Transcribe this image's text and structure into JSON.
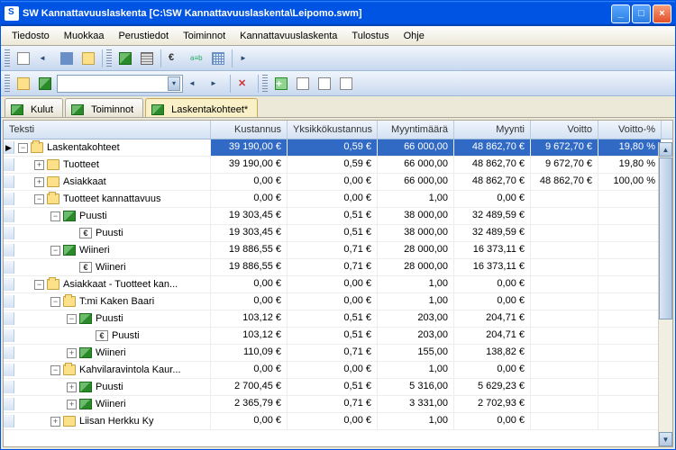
{
  "window": {
    "title": "SW Kannattavuuslaskenta [C:\\SW Kannattavuuslaskenta\\Leipomo.swm]"
  },
  "menubar": {
    "items": [
      "Tiedosto",
      "Muokkaa",
      "Perustiedot",
      "Toiminnot",
      "Kannattavuuslaskenta",
      "Tulostus",
      "Ohje"
    ]
  },
  "tabs": [
    {
      "label": "Kulut",
      "icon": "prod",
      "active": false
    },
    {
      "label": "Toiminnot",
      "icon": "prod",
      "active": false
    },
    {
      "label": "Laskentakohteet*",
      "icon": "prod",
      "active": true
    }
  ],
  "columns": {
    "c0": "Teksti",
    "c1": "Kustannus",
    "c2": "Yksikkökustannus",
    "c3": "Myyntimäärä",
    "c4": "Myynti",
    "c5": "Voitto",
    "c6": "Voitto-%"
  },
  "rows": [
    {
      "depth": 0,
      "marker": "▶",
      "exp": "-",
      "icon": "folder open",
      "label": "Laskentakohteet",
      "sel": true,
      "c1": "39 190,00 €",
      "c2": "0,59 €",
      "c3": "66 000,00",
      "c4": "48 862,70 €",
      "c5": "9 672,70 €",
      "c6": "19,80 %"
    },
    {
      "depth": 1,
      "marker": "",
      "exp": "+",
      "icon": "folder",
      "label": "Tuotteet",
      "c1": "39 190,00 €",
      "c2": "0,59 €",
      "c3": "66 000,00",
      "c4": "48 862,70 €",
      "c5": "9 672,70 €",
      "c6": "19,80 %"
    },
    {
      "depth": 1,
      "marker": "",
      "exp": "+",
      "icon": "folder",
      "label": "Asiakkaat",
      "c1": "0,00 €",
      "c2": "0,00 €",
      "c3": "66 000,00",
      "c4": "48 862,70 €",
      "c5": "48 862,70 €",
      "c6": "100,00 %"
    },
    {
      "depth": 1,
      "marker": "",
      "exp": "-",
      "icon": "folder open",
      "label": "Tuotteet kannattavuus",
      "c1": "0,00 €",
      "c2": "0,00 €",
      "c3": "1,00",
      "c4": "0,00 €",
      "c5": "",
      "c6": ""
    },
    {
      "depth": 2,
      "marker": "",
      "exp": "-",
      "icon": "prod",
      "label": "Puusti",
      "c1": "19 303,45 €",
      "c2": "0,51 €",
      "c3": "38 000,00",
      "c4": "32 489,59 €",
      "c5": "",
      "c6": ""
    },
    {
      "depth": 3,
      "marker": "",
      "exp": " ",
      "icon": "euro",
      "label": "Puusti",
      "c1": "19 303,45 €",
      "c2": "0,51 €",
      "c3": "38 000,00",
      "c4": "32 489,59 €",
      "c5": "",
      "c6": ""
    },
    {
      "depth": 2,
      "marker": "",
      "exp": "-",
      "icon": "prod",
      "label": "Wiineri",
      "c1": "19 886,55 €",
      "c2": "0,71 €",
      "c3": "28 000,00",
      "c4": "16 373,11 €",
      "c5": "",
      "c6": ""
    },
    {
      "depth": 3,
      "marker": "",
      "exp": " ",
      "icon": "euro",
      "label": "Wiineri",
      "c1": "19 886,55 €",
      "c2": "0,71 €",
      "c3": "28 000,00",
      "c4": "16 373,11 €",
      "c5": "",
      "c6": ""
    },
    {
      "depth": 1,
      "marker": "",
      "exp": "-",
      "icon": "folder open",
      "label": "Asiakkaat - Tuotteet kan...",
      "c1": "0,00 €",
      "c2": "0,00 €",
      "c3": "1,00",
      "c4": "0,00 €",
      "c5": "",
      "c6": ""
    },
    {
      "depth": 2,
      "marker": "",
      "exp": "-",
      "icon": "folder open",
      "label": "T:mi Kaken Baari",
      "c1": "0,00 €",
      "c2": "0,00 €",
      "c3": "1,00",
      "c4": "0,00 €",
      "c5": "",
      "c6": ""
    },
    {
      "depth": 3,
      "marker": "",
      "exp": "-",
      "icon": "prod",
      "label": "Puusti",
      "c1": "103,12 €",
      "c2": "0,51 €",
      "c3": "203,00",
      "c4": "204,71 €",
      "c5": "",
      "c6": ""
    },
    {
      "depth": 4,
      "marker": "",
      "exp": " ",
      "icon": "euro",
      "label": "Puusti",
      "c1": "103,12 €",
      "c2": "0,51 €",
      "c3": "203,00",
      "c4": "204,71 €",
      "c5": "",
      "c6": ""
    },
    {
      "depth": 3,
      "marker": "",
      "exp": "+",
      "icon": "prod",
      "label": "Wiineri",
      "c1": "110,09 €",
      "c2": "0,71 €",
      "c3": "155,00",
      "c4": "138,82 €",
      "c5": "",
      "c6": ""
    },
    {
      "depth": 2,
      "marker": "",
      "exp": "-",
      "icon": "folder open",
      "label": "Kahvilaravintola Kaur...",
      "c1": "0,00 €",
      "c2": "0,00 €",
      "c3": "1,00",
      "c4": "0,00 €",
      "c5": "",
      "c6": ""
    },
    {
      "depth": 3,
      "marker": "",
      "exp": "+",
      "icon": "prod",
      "label": "Puusti",
      "c1": "2 700,45 €",
      "c2": "0,51 €",
      "c3": "5 316,00",
      "c4": "5 629,23 €",
      "c5": "",
      "c6": ""
    },
    {
      "depth": 3,
      "marker": "",
      "exp": "+",
      "icon": "prod",
      "label": "Wiineri",
      "c1": "2 365,79 €",
      "c2": "0,71 €",
      "c3": "3 331,00",
      "c4": "2 702,93 €",
      "c5": "",
      "c6": ""
    },
    {
      "depth": 2,
      "marker": "",
      "exp": "+",
      "icon": "folder",
      "label": "Liisan Herkku Ky",
      "c1": "0,00 €",
      "c2": "0,00 €",
      "c3": "1,00",
      "c4": "0,00 €",
      "c5": "",
      "c6": ""
    }
  ]
}
